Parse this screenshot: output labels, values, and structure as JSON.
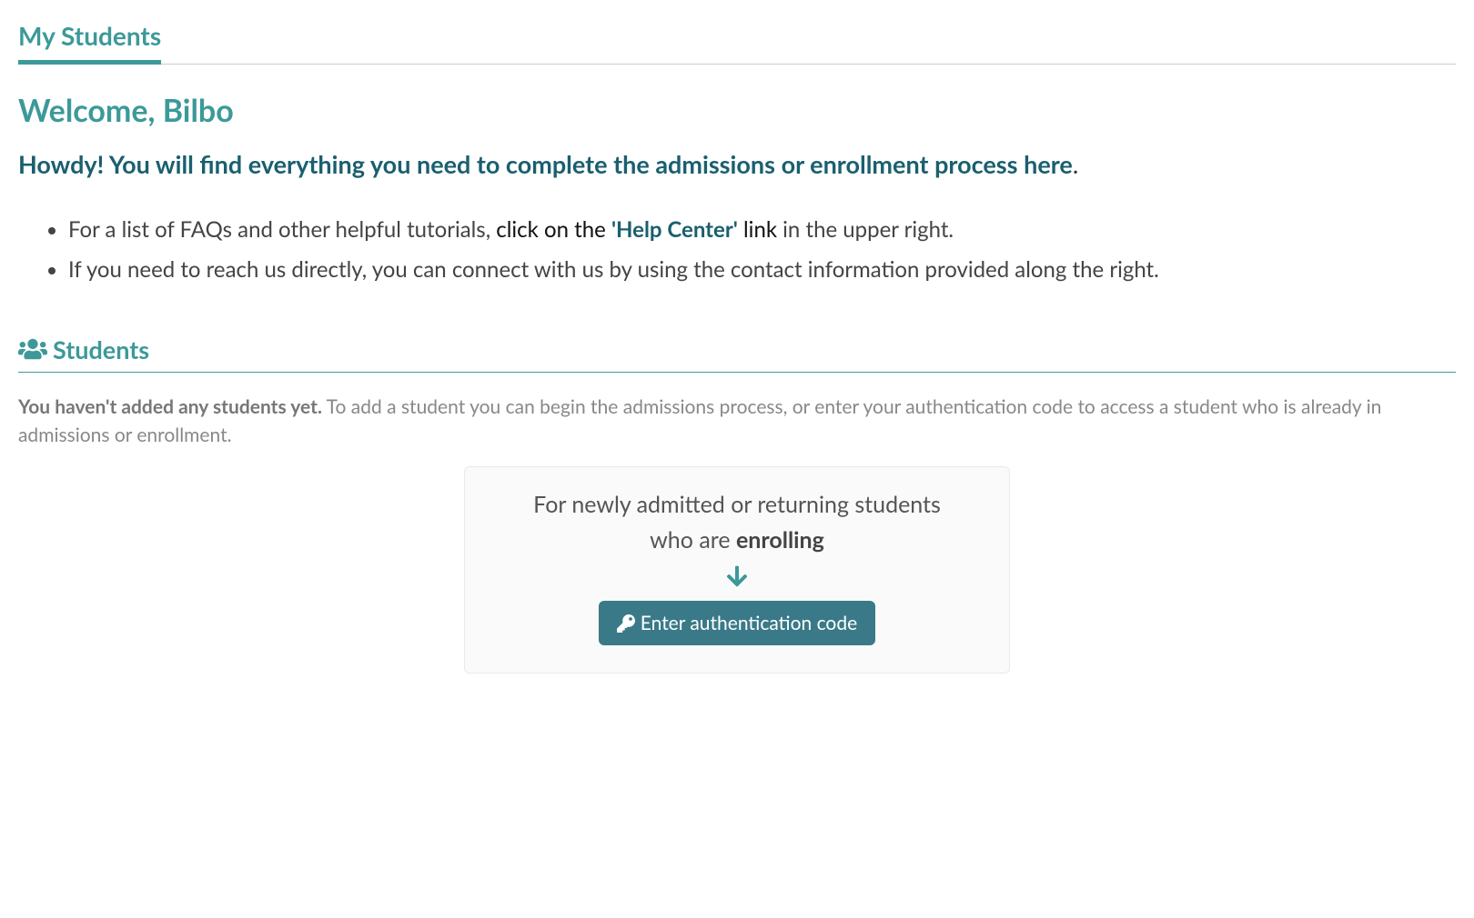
{
  "tab": {
    "label": "My Students"
  },
  "welcome": {
    "heading": "Welcome, Bilbo",
    "intro": "Howdy! You will find everything you need to complete the admissions or enrollment process here",
    "period": "."
  },
  "info": {
    "item1_prefix": "For a list of FAQs and other helpful tutorials, ",
    "item1_click_prefix": "click on the ",
    "item1_link": "'Help Center'",
    "item1_click_suffix": " link",
    "item1_suffix": " in the upper right.",
    "item2": "If you need to reach us directly, you can connect with us by using the contact information provided along the right."
  },
  "students": {
    "heading": "Students",
    "desc_bold": "You haven't added any students yet.",
    "desc_rest": " To add a student you can begin the admissions process, or enter your authentication code to access a student who is already in admissions or enrollment."
  },
  "enroll": {
    "line1": "For newly admitted or returning students",
    "line2_prefix": "who are ",
    "line2_bold": "enrolling",
    "button_label": "Enter authentication code"
  }
}
